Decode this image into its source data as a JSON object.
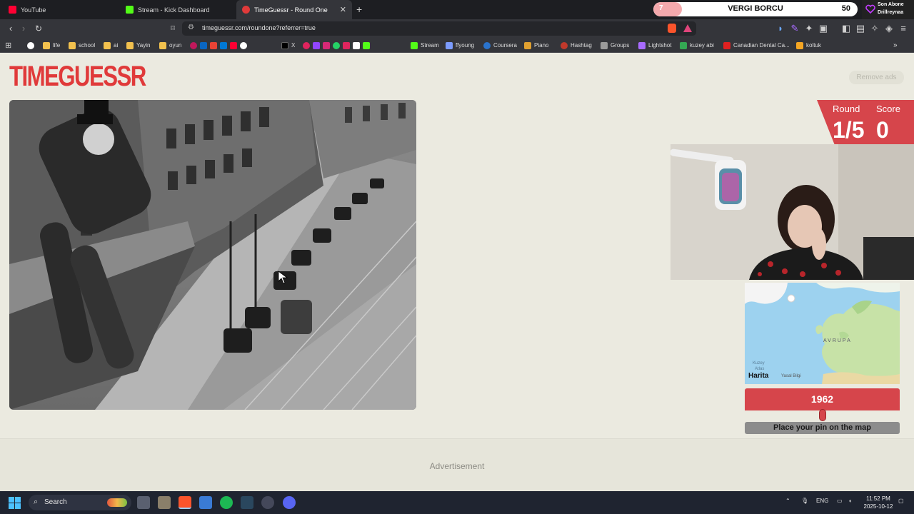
{
  "browser": {
    "tabs": [
      {
        "title": "YouTube",
        "favicon": "youtube-icon",
        "color": "#ff0033"
      },
      {
        "title": "Stream - Kick Dashboard",
        "favicon": "kick-icon",
        "color": "#53fc18"
      },
      {
        "title": "TimeGuessr - Round One",
        "favicon": "timeguessr-icon",
        "color": "#e03a3a",
        "active": true
      }
    ],
    "new_tab_glyph": "+",
    "url": "timeguessr.com/roundone?referrer=true",
    "bookmarks": [
      {
        "label": "",
        "icon": "google-icon",
        "color": "#ffffff"
      },
      {
        "label": "life",
        "icon": "folder-icon",
        "color": "#f2c14e"
      },
      {
        "label": "school",
        "icon": "folder-icon",
        "color": "#f2c14e"
      },
      {
        "label": "ai",
        "icon": "folder-icon",
        "color": "#f2c14e"
      },
      {
        "label": "Yayin",
        "icon": "folder-icon",
        "color": "#f2c14e"
      },
      {
        "label": "oyun",
        "icon": "folder-icon",
        "color": "#f2c14e"
      },
      {
        "label": "X",
        "icon": "x-icon",
        "color": "#ffffff"
      },
      {
        "label": "Stream",
        "icon": "kick-icon",
        "color": "#53fc18"
      },
      {
        "label": "ffyoung",
        "icon": "link-icon",
        "color": "#7c9cff"
      },
      {
        "label": "Coursera",
        "icon": "coursera-icon",
        "color": "#2a73cc"
      },
      {
        "label": "Piano",
        "icon": "piano-icon",
        "color": "#e0a030"
      },
      {
        "label": "Hashtag",
        "icon": "hashtag-icon",
        "color": "#c0392b"
      },
      {
        "label": "Groups",
        "icon": "groups-icon",
        "color": "#9b9b9b"
      },
      {
        "label": "Lightshot",
        "icon": "lightshot-icon",
        "color": "#a86bff"
      },
      {
        "label": "kuzey abi",
        "icon": "drive-icon",
        "color": "#34a853"
      },
      {
        "label": "Canadian Dental Ca...",
        "icon": "leaf-icon",
        "color": "#e02020"
      },
      {
        "label": "koltuk",
        "icon": "koltuk-icon",
        "color": "#f5a623"
      }
    ]
  },
  "overlay": {
    "kick_goal_count": "7",
    "kick_goal_title": "VERGI BORCU",
    "kick_goal_target": "50",
    "kick_goal_progress": 0.14,
    "follower_label": "Son Abone",
    "follower_name": "Drillreynaa"
  },
  "site": {
    "logo": "TIMEGUESSR",
    "remove_ads": "Remove ads",
    "round_label": "Round",
    "round_value": "1/5",
    "score_label": "Score",
    "score_value": "0",
    "year": "1962",
    "year_slider_fraction": 0.5,
    "pin_button": "Place your pin on the map",
    "advertisement": "Advertisement",
    "map": {
      "region_label": "AVRUPA",
      "ocean_label_1": "Kuzey",
      "ocean_label_2": "Atlas",
      "brand": "Harita",
      "legal": "Yasal Bilgi"
    },
    "accent": "#d6454b"
  },
  "taskbar": {
    "search_placeholder": "Search",
    "language": "ENG",
    "time": "11:52 PM",
    "date": "2025-10-12"
  }
}
